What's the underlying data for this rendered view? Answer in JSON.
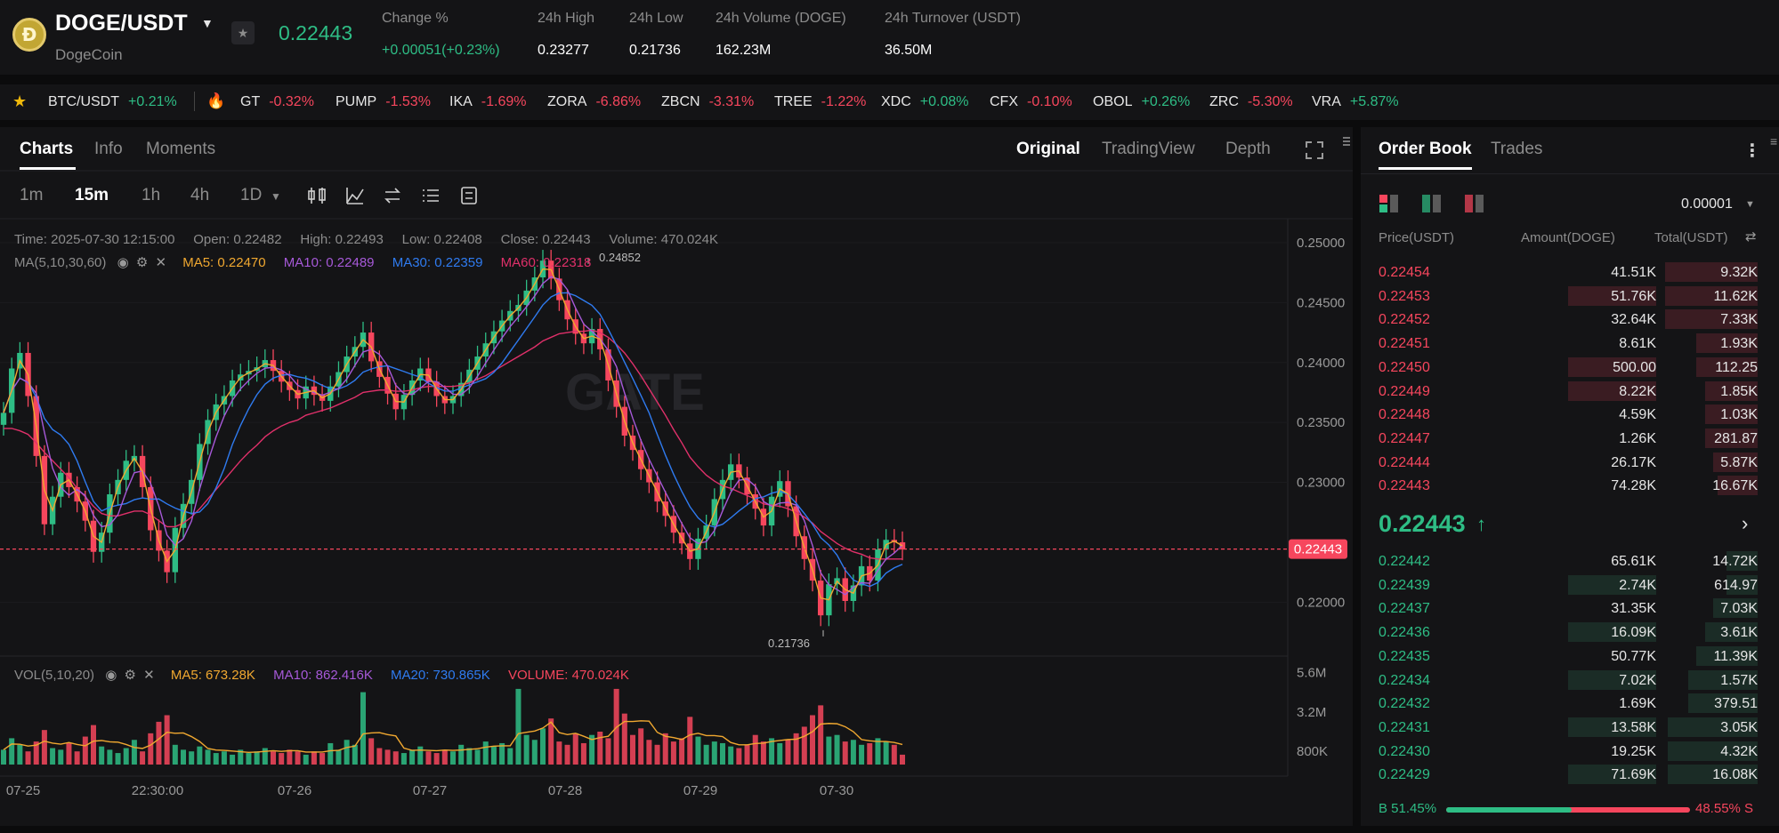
{
  "header": {
    "pair": "DOGE/USDT",
    "coin_name": "DogeCoin",
    "last_price": "0.22443",
    "change_label": "Change %",
    "change_value": "+0.00051(+0.23%)",
    "high_label": "24h High",
    "high_value": "0.23277",
    "low_label": "24h Low",
    "low_value": "0.21736",
    "volume_label": "24h Volume (DOGE)",
    "volume_value": "162.23M",
    "turnover_label": "24h Turnover (USDT)",
    "turnover_value": "36.50M"
  },
  "tickers": [
    {
      "symbol": "BTC/USDT",
      "change": "+0.21%",
      "dir": "up"
    },
    {
      "symbol": "GT",
      "change": "-0.32%",
      "dir": "down"
    },
    {
      "symbol": "PUMP",
      "change": "-1.53%",
      "dir": "down"
    },
    {
      "symbol": "IKA",
      "change": "-1.69%",
      "dir": "down"
    },
    {
      "symbol": "ZORA",
      "change": "-6.86%",
      "dir": "down"
    },
    {
      "symbol": "ZBCN",
      "change": "-3.31%",
      "dir": "down"
    },
    {
      "symbol": "TREE",
      "change": "-1.22%",
      "dir": "down"
    },
    {
      "symbol": "XDC",
      "change": "+0.08%",
      "dir": "up"
    },
    {
      "symbol": "CFX",
      "change": "-0.10%",
      "dir": "down"
    },
    {
      "symbol": "OBOL",
      "change": "+0.26%",
      "dir": "up"
    },
    {
      "symbol": "ZRC",
      "change": "-5.30%",
      "dir": "down"
    },
    {
      "symbol": "VRA",
      "change": "+5.87%",
      "dir": "up"
    }
  ],
  "chart_panel": {
    "tabs": [
      "Charts",
      "Info",
      "Moments"
    ],
    "view_tabs": [
      "Original",
      "TradingView",
      "Depth"
    ],
    "intervals": [
      "1m",
      "15m",
      "1h",
      "4h",
      "1D"
    ],
    "watermark": "GATE"
  },
  "candle_info": {
    "time_label": "Time:",
    "time": "2025-07-30 12:15:00",
    "open_label": "Open:",
    "open": "0.22482",
    "high_label": "High:",
    "high": "0.22493",
    "low_label": "Low:",
    "low": "0.22408",
    "close_label": "Close:",
    "close": "0.22443",
    "volume_label": "Volume:",
    "volume": "470.024K"
  },
  "ma_legend": {
    "label": "MA(5,10,30,60)",
    "ma5": "MA5: 0.22470",
    "ma10": "MA10: 0.22489",
    "ma30": "MA30: 0.22359",
    "ma60": "MA60: 0.22318"
  },
  "vol_legend": {
    "label": "VOL(5,10,20)",
    "ma5": "MA5: 673.28K",
    "ma10": "MA10: 862.416K",
    "ma20": "MA20: 730.865K",
    "volume": "VOLUME: 470.024K"
  },
  "colors": {
    "up": "#2ebd85",
    "down": "#f6465d",
    "ma5": "#f0a830",
    "ma10": "#a659d8",
    "ma30": "#2f7bf0",
    "ma60": "#e0306a"
  },
  "chart_data": {
    "type": "line",
    "title": "",
    "x_ticks": [
      "07-25",
      "22:30:00",
      "07-26",
      "07-27",
      "07-28",
      "07-29",
      "07-30"
    ],
    "price_ticks": [
      "0.25000",
      "0.24500",
      "0.24000",
      "0.23500",
      "0.23000",
      "0.22000"
    ],
    "ylim": [
      0.2155,
      0.252
    ],
    "volume_ticks": [
      "5.6M",
      "3.2M",
      "800K"
    ],
    "current_price": 0.22443,
    "current_price_label": "0.22443",
    "annotations": [
      {
        "label": "0.24852",
        "x": "07-28",
        "value": 0.24852
      },
      {
        "label": "0.21736",
        "x": "07-30",
        "value": 0.21736
      }
    ],
    "series": [
      {
        "name": "Price",
        "values": [
          0.2358,
          0.2395,
          0.2408,
          0.2372,
          0.2322,
          0.2265,
          0.2288,
          0.2308,
          0.2296,
          0.2284,
          0.2268,
          0.2242,
          0.2258,
          0.229,
          0.2302,
          0.2318,
          0.2322,
          0.2296,
          0.226,
          0.2243,
          0.2225,
          0.2262,
          0.2282,
          0.2302,
          0.2332,
          0.2352,
          0.2365,
          0.2372,
          0.2385,
          0.239,
          0.2393,
          0.2396,
          0.2402,
          0.2393,
          0.2384,
          0.2377,
          0.237,
          0.238,
          0.2373,
          0.2368,
          0.238,
          0.2392,
          0.2405,
          0.2413,
          0.2425,
          0.2401,
          0.2388,
          0.2374,
          0.2361,
          0.2373,
          0.2385,
          0.2395,
          0.2384,
          0.2372,
          0.2366,
          0.2372,
          0.2383,
          0.2394,
          0.2405,
          0.2416,
          0.2426,
          0.2435,
          0.2443,
          0.2448,
          0.246,
          0.2471,
          0.2485,
          0.247,
          0.2452,
          0.2436,
          0.2424,
          0.2416,
          0.2428,
          0.2411,
          0.2385,
          0.2363,
          0.2339,
          0.2327,
          0.2311,
          0.23,
          0.2284,
          0.2272,
          0.2258,
          0.2249,
          0.2236,
          0.2253,
          0.2264,
          0.2286,
          0.2302,
          0.2315,
          0.2304,
          0.229,
          0.2278,
          0.2264,
          0.2288,
          0.2301,
          0.228,
          0.2255,
          0.2236,
          0.2218,
          0.2189,
          0.2215,
          0.222,
          0.2201,
          0.2214,
          0.223,
          0.2218,
          0.2244,
          0.2252,
          0.225,
          0.2244
        ]
      },
      {
        "name": "MA60",
        "values": [
          0.2345,
          0.2345,
          0.2343,
          0.234,
          0.2333,
          0.2325,
          0.2318,
          0.2311,
          0.2304,
          0.2295,
          0.2288,
          0.228,
          0.2274,
          0.2272,
          0.2272,
          0.2274,
          0.2276,
          0.2276,
          0.2273,
          0.2268,
          0.2263,
          0.2263,
          0.2266,
          0.2271,
          0.2278,
          0.2286,
          0.2294,
          0.2302,
          0.231,
          0.2318,
          0.2325,
          0.2331,
          0.2338,
          0.2343,
          0.2347,
          0.235,
          0.2352,
          0.2356,
          0.2358,
          0.236,
          0.2362,
          0.2365,
          0.2368,
          0.2371,
          0.2375,
          0.2376,
          0.2377,
          0.2377,
          0.2376,
          0.2376,
          0.2377,
          0.2379,
          0.238,
          0.238,
          0.238,
          0.238,
          0.2381,
          0.2383,
          0.2386,
          0.2389,
          0.2393,
          0.2397,
          0.2401,
          0.2405,
          0.2409,
          0.2413,
          0.2418,
          0.2421,
          0.2424,
          0.2425,
          0.2426,
          0.2426,
          0.2427,
          0.2425,
          0.2421,
          0.2415,
          0.2408,
          0.2399,
          0.2389,
          0.2378,
          0.2367,
          0.2356,
          0.2344,
          0.2333,
          0.2321,
          0.2313,
          0.2306,
          0.2301,
          0.2297,
          0.2295,
          0.2292,
          0.2289,
          0.2286,
          0.2282,
          0.2281,
          0.228,
          0.2278,
          0.2275,
          0.2271,
          0.2266,
          0.2259,
          0.2254,
          0.2249,
          0.2245,
          0.2242,
          0.224,
          0.2237,
          0.2236,
          0.2236,
          0.2236,
          0.2236
        ]
      }
    ],
    "volume": [
      0.9,
      1.6,
      1.2,
      0.8,
      1.4,
      2.1,
      1.0,
      0.9,
      1.3,
      0.8,
      1.7,
      2.4,
      1.1,
      0.9,
      0.7,
      1.0,
      1.5,
      0.8,
      1.9,
      2.6,
      3.0,
      1.2,
      0.9,
      0.8,
      1.1,
      0.9,
      0.7,
      0.8,
      0.6,
      0.9,
      0.7,
      0.8,
      1.0,
      0.8,
      0.7,
      0.9,
      0.8,
      0.6,
      0.8,
      0.7,
      1.3,
      0.9,
      1.5,
      1.2,
      4.4,
      1.6,
      1.0,
      0.9,
      0.8,
      0.7,
      0.9,
      1.1,
      0.8,
      0.7,
      0.9,
      0.8,
      1.2,
      1.0,
      0.9,
      1.4,
      1.1,
      1.3,
      1.0,
      4.6,
      1.8,
      1.5,
      2.2,
      2.8,
      1.4,
      1.2,
      1.9,
      1.3,
      1.8,
      2.0,
      1.6,
      4.6,
      3.1,
      1.8,
      2.2,
      1.5,
      1.2,
      1.9,
      1.4,
      1.6,
      2.9,
      1.7,
      1.2,
      1.4,
      1.3,
      1.1,
      1.0,
      1.2,
      1.8,
      1.4,
      1.6,
      1.3,
      1.5,
      1.9,
      2.3,
      3.0,
      3.6,
      1.7,
      1.8,
      1.4,
      1.5,
      1.2,
      1.3,
      1.6,
      1.4,
      1.2,
      0.6
    ]
  },
  "order_book": {
    "tabs": [
      "Order Book",
      "Trades"
    ],
    "precision": "0.00001",
    "col_price": "Price(USDT)",
    "col_amount": "Amount(DOGE)",
    "col_total": "Total(USDT)",
    "mid_price": "0.22443",
    "asks": [
      {
        "price": "0.22454",
        "amount": "41.51K",
        "total": "9.32K",
        "amount_depth": 0,
        "total_depth": 0.74
      },
      {
        "price": "0.22453",
        "amount": "51.76K",
        "total": "11.62K",
        "amount_depth": 0.71,
        "total_depth": 0.74
      },
      {
        "price": "0.22452",
        "amount": "32.64K",
        "total": "7.33K",
        "amount_depth": 0,
        "total_depth": 0.74
      },
      {
        "price": "0.22451",
        "amount": "8.61K",
        "total": "1.93K",
        "amount_depth": 0,
        "total_depth": 0.49
      },
      {
        "price": "0.22450",
        "amount": "500.00",
        "total": "112.25",
        "amount_depth": 0.71,
        "total_depth": 0.49
      },
      {
        "price": "0.22449",
        "amount": "8.22K",
        "total": "1.85K",
        "amount_depth": 0.71,
        "total_depth": 0.42
      },
      {
        "price": "0.22448",
        "amount": "4.59K",
        "total": "1.03K",
        "amount_depth": 0,
        "total_depth": 0.42
      },
      {
        "price": "0.22447",
        "amount": "1.26K",
        "total": "281.87",
        "amount_depth": 0,
        "total_depth": 0.42
      },
      {
        "price": "0.22444",
        "amount": "26.17K",
        "total": "5.87K",
        "amount_depth": 0,
        "total_depth": 0.36
      },
      {
        "price": "0.22443",
        "amount": "74.28K",
        "total": "16.67K",
        "amount_depth": 0,
        "total_depth": 0.32
      }
    ],
    "bids": [
      {
        "price": "0.22442",
        "amount": "65.61K",
        "total": "14.72K",
        "amount_depth": 0,
        "total_depth": 0.25
      },
      {
        "price": "0.22439",
        "amount": "2.74K",
        "total": "614.97",
        "amount_depth": 0.71,
        "total_depth": 0.25
      },
      {
        "price": "0.22437",
        "amount": "31.35K",
        "total": "7.03K",
        "amount_depth": 0,
        "total_depth": 0.36
      },
      {
        "price": "0.22436",
        "amount": "16.09K",
        "total": "3.61K",
        "amount_depth": 0.71,
        "total_depth": 0.42
      },
      {
        "price": "0.22435",
        "amount": "50.77K",
        "total": "11.39K",
        "amount_depth": 0,
        "total_depth": 0.49
      },
      {
        "price": "0.22434",
        "amount": "7.02K",
        "total": "1.57K",
        "amount_depth": 0.71,
        "total_depth": 0.56
      },
      {
        "price": "0.22432",
        "amount": "1.69K",
        "total": "379.51",
        "amount_depth": 0,
        "total_depth": 0.56
      },
      {
        "price": "0.22431",
        "amount": "13.58K",
        "total": "3.05K",
        "amount_depth": 0.71,
        "total_depth": 0.72
      },
      {
        "price": "0.22430",
        "amount": "19.25K",
        "total": "4.32K",
        "amount_depth": 0,
        "total_depth": 0.72
      },
      {
        "price": "0.22429",
        "amount": "71.69K",
        "total": "16.08K",
        "amount_depth": 0.71,
        "total_depth": 0.72
      }
    ],
    "buy_label": "B 51.45%",
    "sell_label": "48.55% S",
    "buy_ratio": 0.5145
  }
}
